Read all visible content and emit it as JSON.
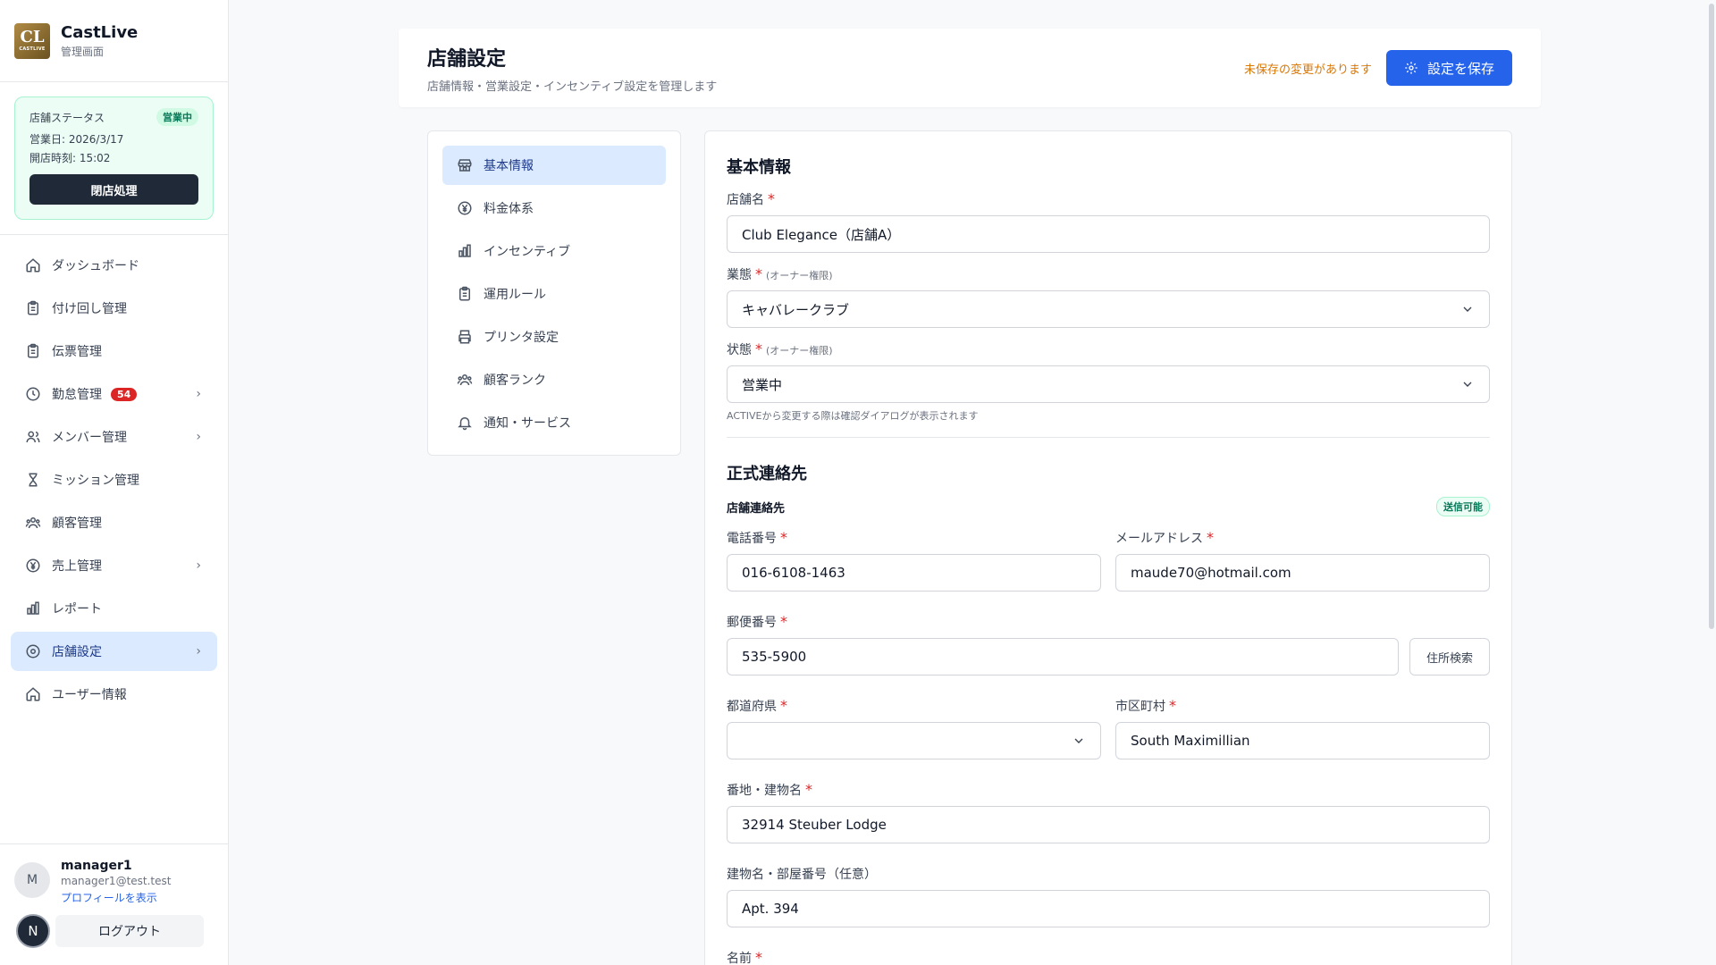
{
  "brand": {
    "name": "CastLive",
    "subtitle": "管理画面",
    "logo_text": "CL",
    "logo_small": "CASTLIVE"
  },
  "status_card": {
    "title": "店舗ステータス",
    "badge": "営業中",
    "business_day": "営業日: 2026/3/17",
    "open_time": "開店時刻: 15:02",
    "close_button": "閉店処理"
  },
  "nav": {
    "items": [
      {
        "label": "ダッシュボード",
        "icon": "home-icon"
      },
      {
        "label": "付け回し管理",
        "icon": "clipboard-icon"
      },
      {
        "label": "伝票管理",
        "icon": "clipboard-icon"
      },
      {
        "label": "勤怠管理",
        "icon": "clock-icon",
        "badge": "54",
        "chevron": true
      },
      {
        "label": "メンバー管理",
        "icon": "users-icon",
        "chevron": true
      },
      {
        "label": "ミッション管理",
        "icon": "hourglass-icon"
      },
      {
        "label": "顧客管理",
        "icon": "customers-icon"
      },
      {
        "label": "売上管理",
        "icon": "yen-icon",
        "chevron": true
      },
      {
        "label": "レポート",
        "icon": "bar-chart-icon"
      },
      {
        "label": "店舗設定",
        "icon": "settings-icon",
        "chevron": true,
        "active": true
      },
      {
        "label": "ユーザー情報",
        "icon": "home-icon"
      }
    ]
  },
  "user": {
    "initial": "M",
    "name": "manager1",
    "email": "manager1@test.test",
    "profile_link": "プロフィールを表示",
    "n_badge": "N",
    "logout": "ログアウト"
  },
  "header": {
    "title": "店舗設定",
    "subtitle": "店舗情報・営業設定・インセンティブ設定を管理します",
    "unsaved": "未保存の変更があります",
    "save_button": "設定を保存"
  },
  "sub_nav": {
    "items": [
      {
        "label": "基本情報",
        "icon": "store-icon",
        "active": true
      },
      {
        "label": "料金体系",
        "icon": "yen-icon"
      },
      {
        "label": "インセンティブ",
        "icon": "bar-chart-icon"
      },
      {
        "label": "運用ルール",
        "icon": "clipboard-icon"
      },
      {
        "label": "プリンタ設定",
        "icon": "printer-icon"
      },
      {
        "label": "顧客ランク",
        "icon": "customers-icon"
      },
      {
        "label": "通知・サービス",
        "icon": "bell-icon"
      }
    ]
  },
  "form": {
    "basic_title": "基本情報",
    "store_name": {
      "label": "店舗名",
      "value": "Club Elegance（店舗A）"
    },
    "business_type": {
      "label": "業態",
      "note": "(オーナー権限)",
      "value": "キャバレークラブ"
    },
    "state": {
      "label": "状態",
      "note": "(オーナー権限)",
      "value": "営業中",
      "hint": "ACTIVEから変更する際は確認ダイアログが表示されます"
    },
    "contact_title": "正式連絡先",
    "store_contact": "店舗連絡先",
    "send_badge": "送信可能",
    "phone": {
      "label": "電話番号",
      "value": "016-6108-1463"
    },
    "email": {
      "label": "メールアドレス",
      "value": "maude70@hotmail.com"
    },
    "zip": {
      "label": "郵便番号",
      "value": "535-5900",
      "button": "住所検索"
    },
    "prefecture": {
      "label": "都道府県",
      "value": ""
    },
    "city": {
      "label": "市区町村",
      "value": "South Maximillian"
    },
    "street": {
      "label": "番地・建物名",
      "value": "32914 Steuber Lodge"
    },
    "building": {
      "label": "建物名・部屋番号（任意）",
      "value": "Apt. 394"
    },
    "name": {
      "label": "名前",
      "value": ""
    }
  },
  "colors": {
    "primary": "#2563eb",
    "active_bg": "#dbeafe",
    "warning": "#d97706",
    "success": "#047857",
    "danger": "#dc2626"
  }
}
